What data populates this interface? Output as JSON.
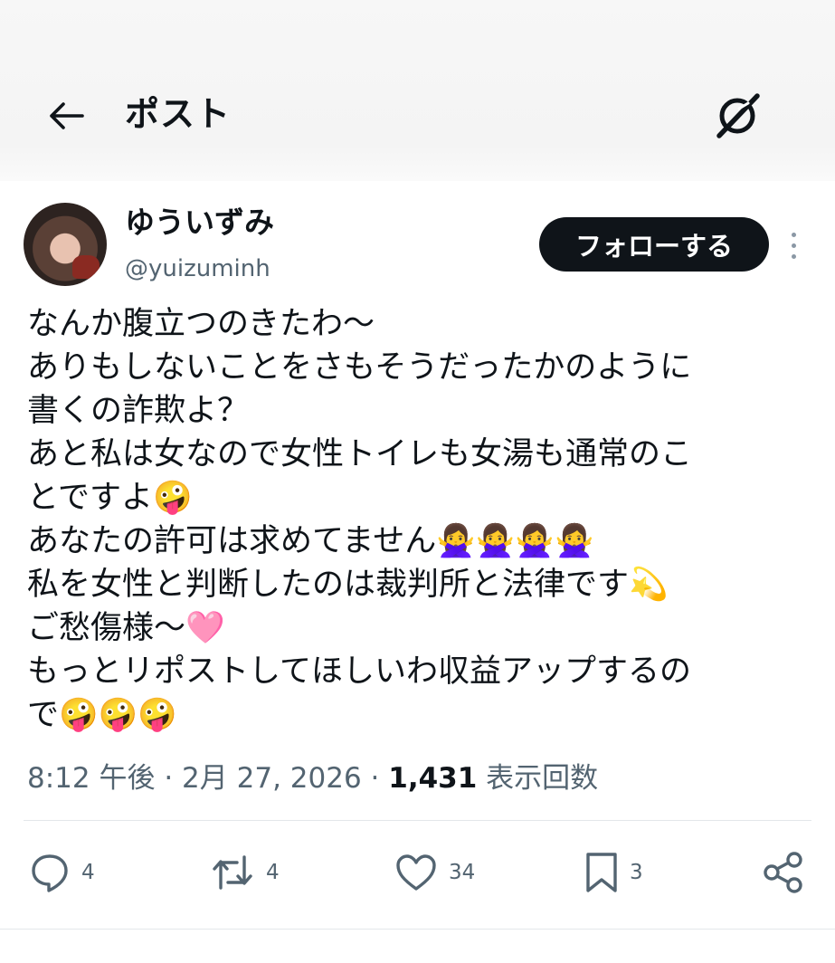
{
  "header": {
    "title": "ポスト"
  },
  "author": {
    "display_name": "ゆういずみ",
    "handle": "@yuizuminh",
    "follow_label": "フォローする"
  },
  "tweet": {
    "lines": [
      "なんか腹立つのきたわ〜",
      "ありもしないことをさもそうだったかのように",
      "書くの詐欺よ？",
      "あと私は女なので女性トイレも女湯も通常のこ",
      "とですよ🤪",
      "あなたの許可は求めてません🙅‍♀️🙅‍♀️🙅‍♀️🙅‍♀️",
      "私を女性と判断したのは裁判所と法律です💫",
      "ご愁傷様〜🩷",
      "もっとリポストしてほしいわ収益アップするの",
      "で🤪🤪🤪"
    ]
  },
  "meta": {
    "time": "8:12 午後",
    "date": "2月 27, 2026",
    "views_count": "1,431",
    "views_label": "表示回数"
  },
  "actions": {
    "replies": "4",
    "reposts": "4",
    "likes": "34",
    "bookmarks": "3"
  },
  "icons": {
    "back": "arrow-left-icon",
    "grok": "grok-icon",
    "more": "more-vertical-icon",
    "reply": "reply-icon",
    "repost": "repost-icon",
    "like": "heart-icon",
    "bookmark": "bookmark-icon",
    "share": "share-icon"
  },
  "colors": {
    "text": "#0f1419",
    "secondary": "#536471",
    "follow_button": "#0f1419"
  }
}
